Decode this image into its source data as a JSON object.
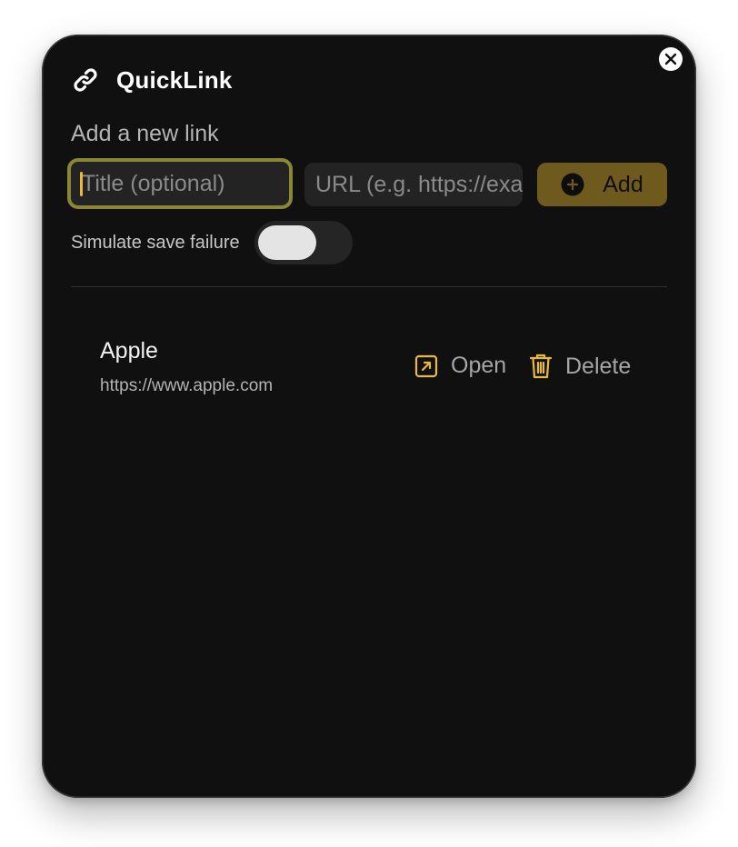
{
  "app": {
    "title": "QuickLink",
    "icon": "link-icon",
    "close_icon": "close-icon"
  },
  "form": {
    "section_label": "Add a new link",
    "title_input": {
      "placeholder": "Title (optional)",
      "value": ""
    },
    "url_input": {
      "placeholder": "URL (e.g. https://example.com)",
      "value": ""
    },
    "add_button": {
      "label": "Add",
      "icon": "plus-circle-icon"
    },
    "simulate_failure": {
      "label": "Simulate save failure",
      "enabled": false
    }
  },
  "links": [
    {
      "title": "Apple",
      "url": "https://www.apple.com",
      "open_label": "Open",
      "open_icon": "open-external-icon",
      "delete_label": "Delete",
      "delete_icon": "trash-icon"
    }
  ],
  "colors": {
    "accent": "#e8b93a",
    "focus_ring": "#8b8636",
    "add_button_bg": "#6f5a1e",
    "window_bg": "#101010"
  }
}
